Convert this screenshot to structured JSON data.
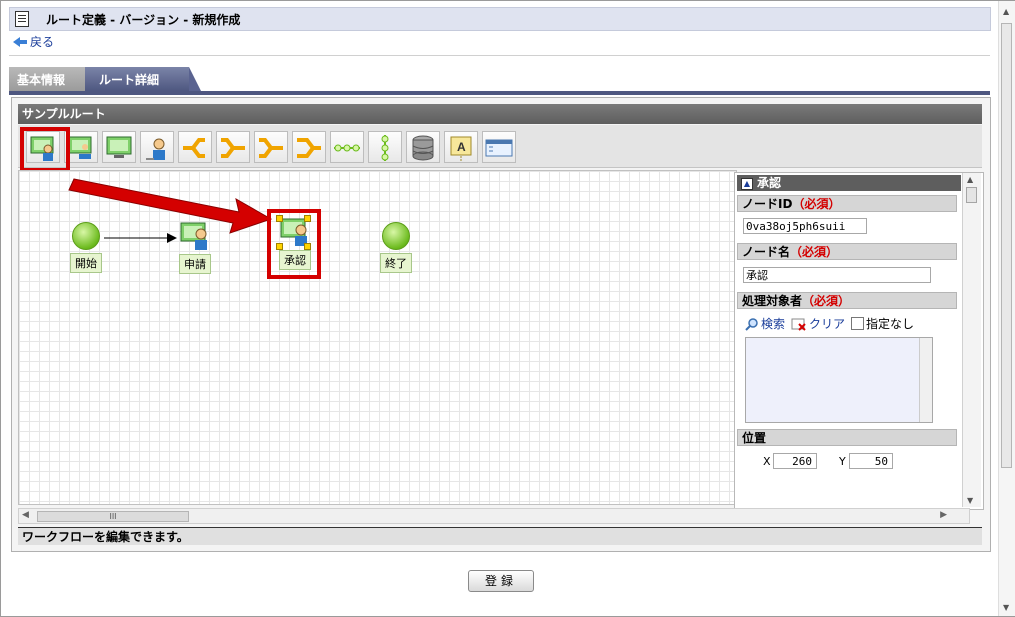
{
  "title": "ルート定義 - バージョン - 新規作成",
  "back_label": "戻る",
  "tabs": [
    {
      "label": "基本情報",
      "active": false
    },
    {
      "label": "ルート詳細",
      "active": true
    }
  ],
  "route": {
    "name": "サンプルルート",
    "status_message": "ワークフローを編集できます。"
  },
  "toolbar_tools": [
    "user-node-icon",
    "user-node-alt-icon",
    "system-node-icon",
    "person-icon",
    "branch-split-icon",
    "branch-join-icon",
    "branch-split-alt-icon",
    "branch-join-alt-icon",
    "horizontal-line-icon",
    "vertical-line-icon",
    "database-icon",
    "text-annotation-icon",
    "window-icon"
  ],
  "canvas": {
    "nodes": [
      {
        "label": "開始",
        "type": "start"
      },
      {
        "label": "申請",
        "type": "user"
      },
      {
        "label": "承認",
        "type": "user",
        "selected": true
      },
      {
        "label": "終了",
        "type": "end"
      }
    ],
    "hscroll_thumb": "III"
  },
  "properties": {
    "title": "承認",
    "node_id_label": "ノードID",
    "required_text": "（必須）",
    "node_id_value": "0va38oj5ph6suii",
    "node_name_label": "ノード名",
    "node_name_value": "承認",
    "assignee_label": "処理対象者",
    "search_label": "検索",
    "clear_label": "クリア",
    "unspecified_label": "指定なし",
    "position_label": "位置",
    "x_label": "X",
    "x_value": "260",
    "y_label": "Y",
    "y_value": "50"
  },
  "submit_label": "登録",
  "colors": {
    "highlight_red": "#d40000",
    "tab_active": "#4e5780",
    "node_green": "#6cbb1e"
  }
}
